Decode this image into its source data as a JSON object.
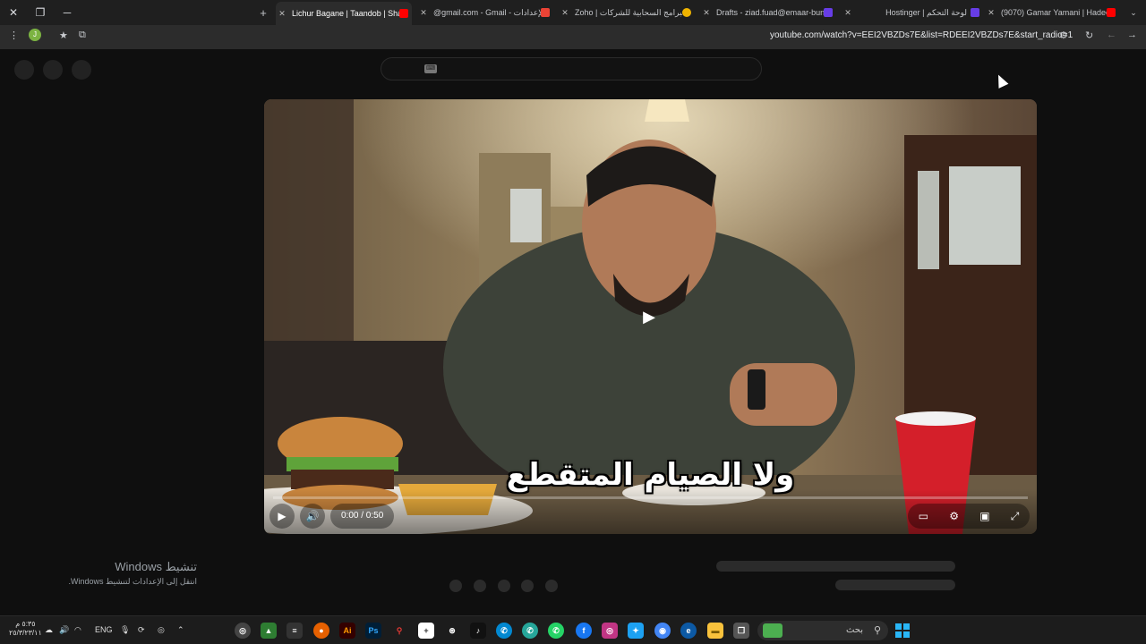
{
  "tabs": [
    {
      "label": "Lichur Bagane | Taandob | Shal:",
      "active": true,
      "favicon_color": "#ff0000"
    },
    {
      "label": "@gmail.com - Gmail - الإعدادات",
      "active": false,
      "favicon_color": "#ea4335"
    },
    {
      "label": "Zoho | البرامج السحابية للشركات",
      "active": false,
      "favicon_color": "#f0b400"
    },
    {
      "label": "Drafts - ziad.fuad@emaar-bun:",
      "active": false,
      "favicon_color": "#673de6"
    },
    {
      "label": "Hostinger | لوحة التحكم",
      "active": false,
      "favicon_color": "#673de6"
    },
    {
      "label": "(9070) Gamar Yamani | Hadeel",
      "active": false,
      "favicon_color": "#ff0000"
    }
  ],
  "address_bar": {
    "url": "youtube.com/watch?v=EEI2VBZDs7E&list=RDEEI2VBZDs7E&start_radio=1",
    "profile_initial": "J"
  },
  "search": {
    "keyboard_label": "⌨"
  },
  "video": {
    "caption": "ولا الصيام المتقطع",
    "time": "0:00 / 0:50",
    "progress": 0
  },
  "activation": {
    "title": "تنشيط Windows",
    "subtitle": "انتقل إلى الإعدادات لتنشيط Windows."
  },
  "taskbar": {
    "clock_time": "٥:٣٥ م",
    "clock_date": "٢٥/٣/٢٣/١١",
    "language": "ENG",
    "search_placeholder": "بحث"
  },
  "colors": {
    "accent": "#ff0000",
    "background": "#0f0f0f"
  }
}
